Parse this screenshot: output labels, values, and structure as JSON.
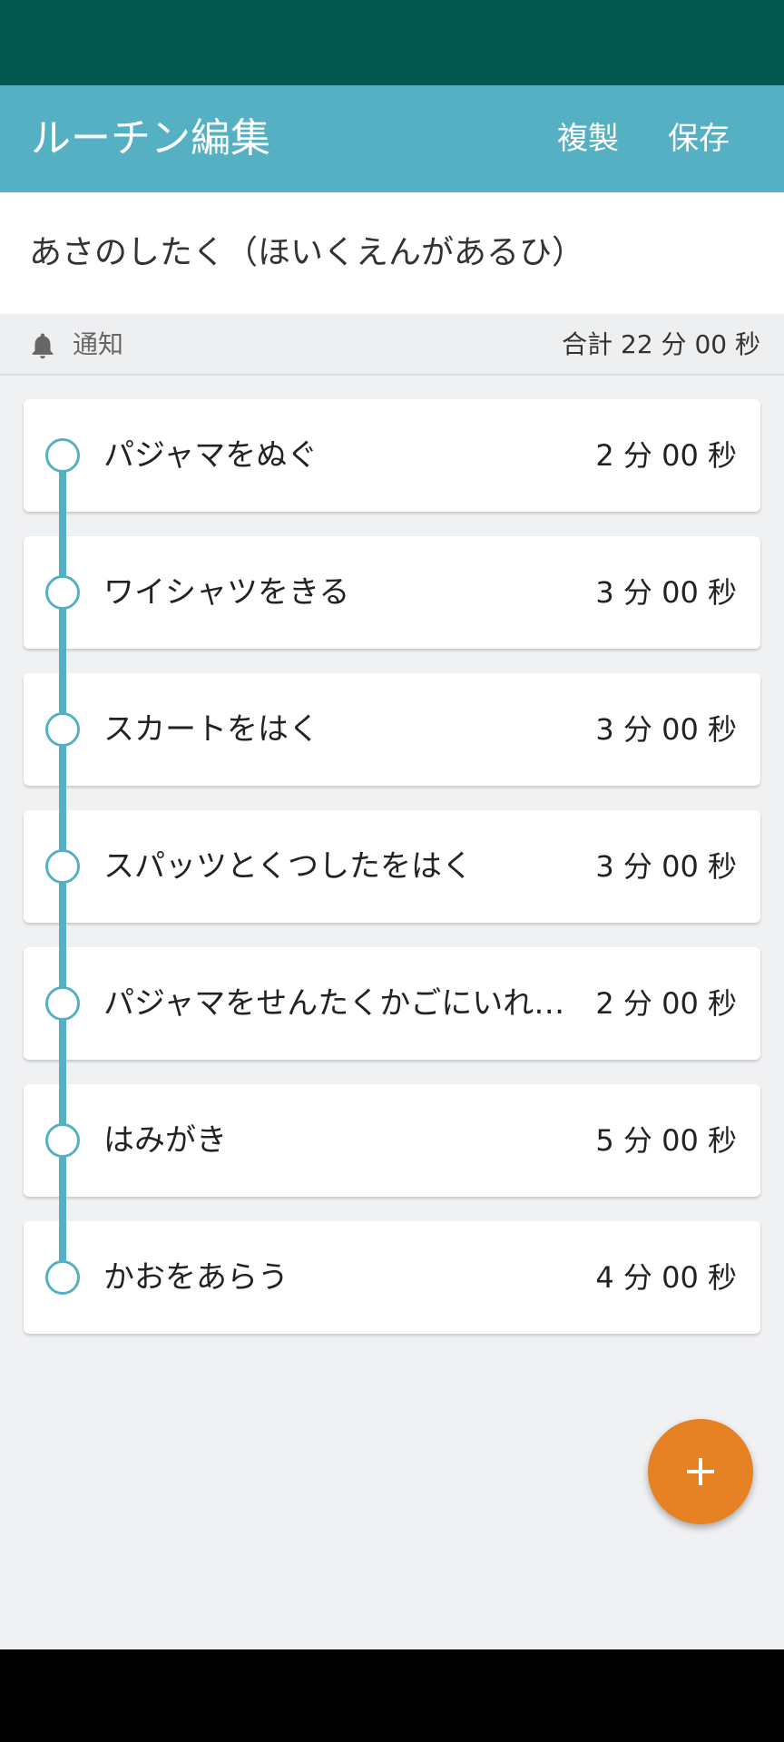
{
  "app_bar": {
    "title": "ルーチン編集",
    "duplicate_label": "複製",
    "save_label": "保存"
  },
  "routine": {
    "name": "あさのしたく（ほいくえんがあるひ）"
  },
  "info": {
    "notification_label": "通知",
    "total": "合計 22 分 00 秒"
  },
  "tasks": [
    {
      "name": "パジャマをぬぐ",
      "time": "2 分 00 秒"
    },
    {
      "name": "ワイシャツをきる",
      "time": "3 分 00 秒"
    },
    {
      "name": "スカートをはく",
      "time": "3 分 00 秒"
    },
    {
      "name": "スパッツとくつしたをはく",
      "time": "3 分 00 秒"
    },
    {
      "name": "パジャマをせんたくかごにいれ…",
      "time": "2 分 00 秒"
    },
    {
      "name": "はみがき",
      "time": "5 分 00 秒"
    },
    {
      "name": "かおをあらう",
      "time": "4 分 00 秒"
    }
  ],
  "fab": {
    "icon": "plus-icon"
  },
  "colors": {
    "status_bar": "#02584c",
    "app_bar": "#55b0c3",
    "accent": "#55b0c3",
    "fab": "#e68223"
  }
}
